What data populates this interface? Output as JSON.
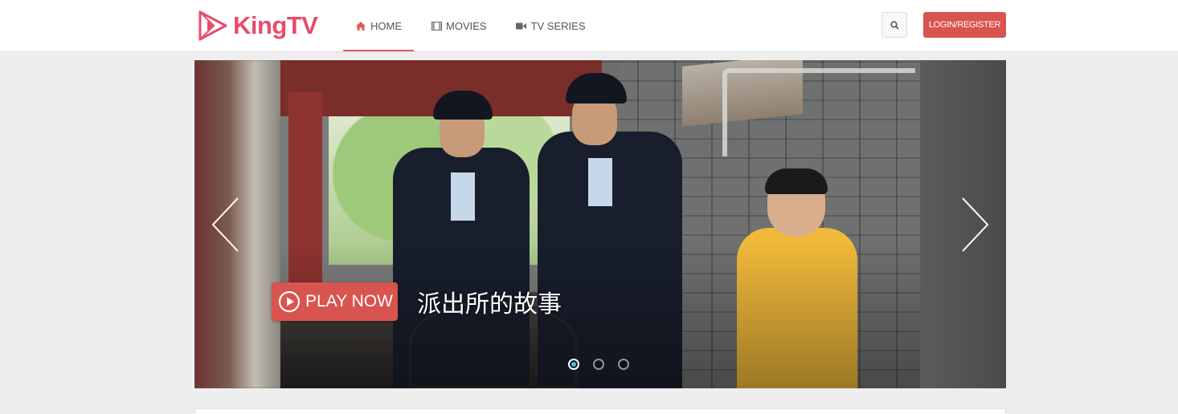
{
  "brand": {
    "name": "KingTV",
    "color": "#e74c6c",
    "logo_icon": "play-triangle-logo"
  },
  "nav": {
    "items": [
      {
        "label": "HOME",
        "icon": "home-icon",
        "active": true
      },
      {
        "label": "MOVIES",
        "icon": "film-icon",
        "active": false
      },
      {
        "label": "TV SERIES",
        "icon": "video-camera-icon",
        "active": false
      }
    ]
  },
  "header": {
    "search_icon": "search-icon",
    "login_label": "LOGIN/REGISTER"
  },
  "slider": {
    "play_label": "PLAY NOW",
    "title": "派出所的故事",
    "slide_count": 3,
    "active_slide": 1
  },
  "colors": {
    "accent": "#d9534f",
    "active_dot": "#3ec6d6"
  }
}
